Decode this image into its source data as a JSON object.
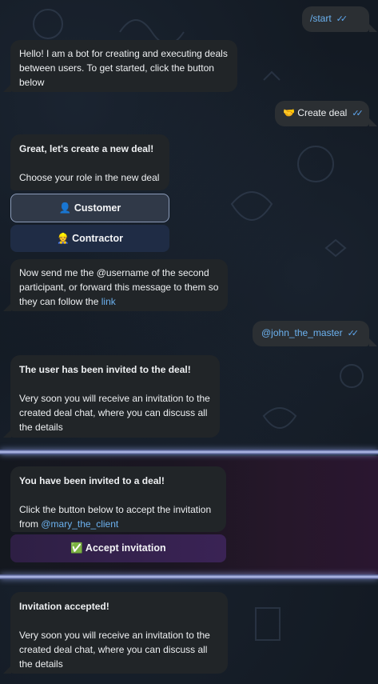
{
  "messages": {
    "start_cmd": "/start",
    "greeting": "Hello! I am a bot for creating and executing deals between users. To get started, click the button below",
    "create_deal": "🤝 Create deal",
    "role_title": "Great, let's create a new deal!",
    "role_body": "Choose your role in the new deal",
    "customer_btn": "👤 Customer",
    "contractor_btn": "👷 Contractor",
    "send_username_text": "Now send me the @username of the second participant, or forward this message to them so they can follow the",
    "send_username_link": "link",
    "username_sent": "@john_the_master",
    "invited_title": "The user has been invited to the deal!",
    "invited_body": "Very soon you will receive an invitation to the created deal chat, where you can discuss all the details",
    "invite_title": "You have been invited to a deal!",
    "invite_body": "Click the button below to accept the invitation from",
    "invite_from": "@mary_the_client",
    "accept_btn": "✅ Accept invitation",
    "accepted_title": "Invitation accepted!",
    "accepted_body": "Very soon you will receive an invitation to the created deal chat, where you can discuss all the details"
  },
  "colors": {
    "bubble": "#212528",
    "link": "#6cb2f0",
    "ticks": "#5fa8f0",
    "separator": "#b9c3f2"
  },
  "icons": [
    "double-check-icon"
  ]
}
